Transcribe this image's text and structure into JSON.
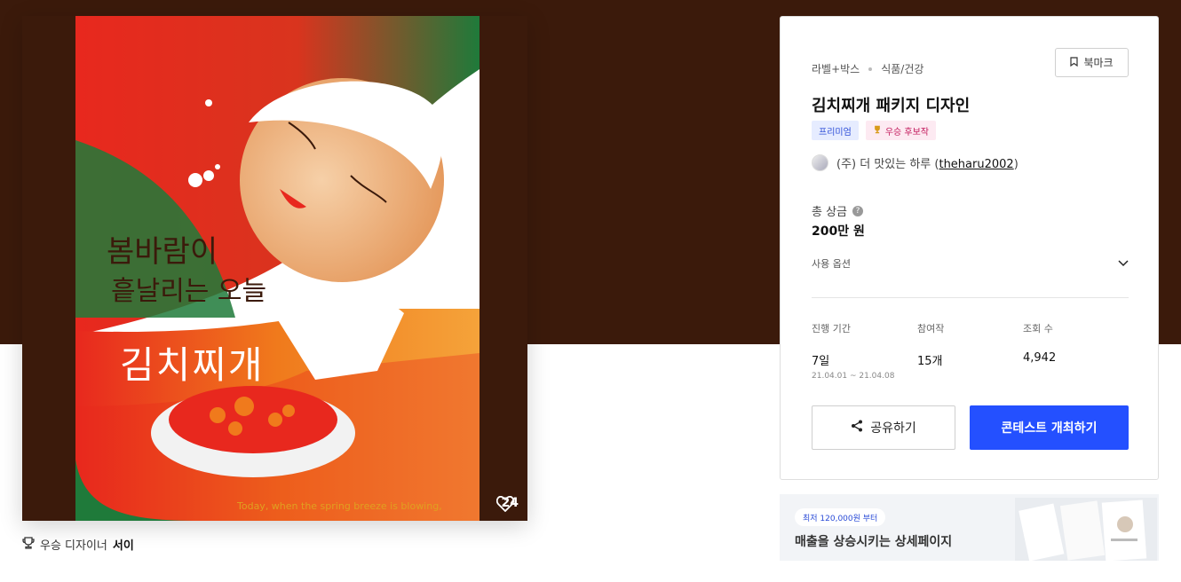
{
  "artwork": {
    "poem_line1": "봄바람이",
    "poem_line2": "흩날리는 오늘",
    "product_name": "김치찌개",
    "tagline": "Today, when the spring breeze is blowing,",
    "like_count": "24",
    "like_icon": "heart-icon"
  },
  "winner_line": {
    "prefix": "우승 디자이너",
    "name": "서이",
    "icon": "trophy-icon"
  },
  "card": {
    "category": "라벨+박스",
    "subcategory": "식품/건강",
    "bookmark_label": "북마크",
    "title": "김치찌개 패키지 디자인",
    "badges": {
      "premium": "프리미엄",
      "winner": "우승 후보작"
    },
    "owner": {
      "company": "(주) 더 맛있는 하루 (",
      "handle": "theharu2002",
      "close": ")"
    },
    "prize_label": "총 상금",
    "prize_value": "200만 원",
    "usage_label": "사용 옵션",
    "stats": {
      "period": {
        "label": "진행 기간",
        "value": "7일",
        "sub": "21.04.01 ~ 21.04.08"
      },
      "entries": {
        "label": "참여작",
        "value": "15개"
      },
      "views": {
        "label": "조회 수",
        "value": "4,942"
      }
    },
    "share_label": "공유하기",
    "host_label": "콘테스트 개최하기"
  },
  "banner": {
    "tag": "최저 120,000원 부터",
    "headline": "매출을 상승시키는 상세페이지"
  },
  "colors": {
    "hero": "#3b1a0b",
    "accent": "#2450ff",
    "red": "#e8281e",
    "green": "#1f7a3a"
  }
}
